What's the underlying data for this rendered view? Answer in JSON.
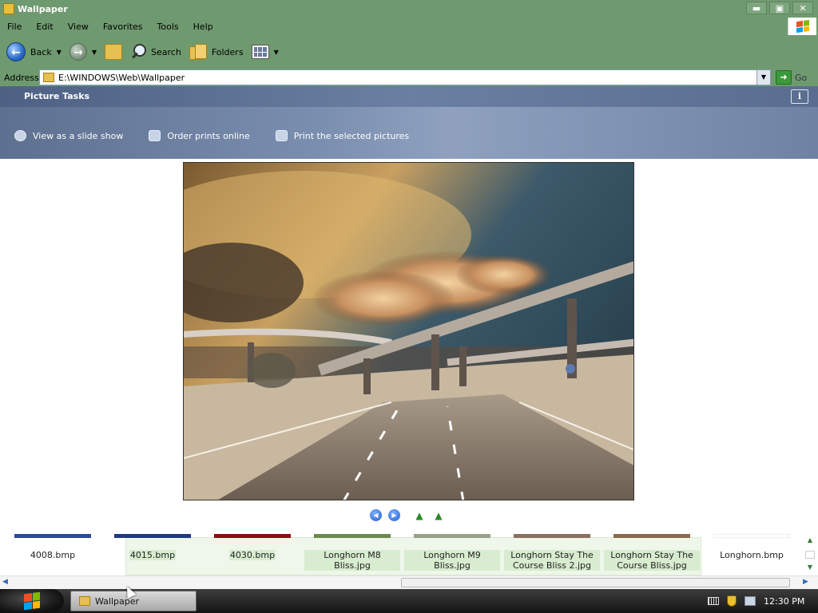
{
  "window": {
    "title": "Wallpaper",
    "min": "▬",
    "max": "▣",
    "close": "✕"
  },
  "menu": [
    "File",
    "Edit",
    "View",
    "Favorites",
    "Tools",
    "Help"
  ],
  "toolbar": {
    "back": "Back",
    "search": "Search",
    "folders": "Folders"
  },
  "address": {
    "label": "Address",
    "value": "E:\\WINDOWS\\Web\\Wallpaper",
    "go": "Go"
  },
  "tasks": {
    "title": "Picture Tasks",
    "info": "i",
    "items": [
      {
        "label": "View as a slide show",
        "icon": "slideshow-icon"
      },
      {
        "label": "Order prints online",
        "icon": "order-prints-icon"
      },
      {
        "label": "Print the selected pictures",
        "icon": "printer-icon"
      }
    ]
  },
  "filmstrip": {
    "items": [
      {
        "name": "4008.bmp",
        "strip": "#2a4a9a",
        "selected": false
      },
      {
        "name": "4015.bmp",
        "strip": "#1f3a80",
        "selected": true
      },
      {
        "name": "4030.bmp",
        "strip": "#8a1010",
        "selected": true
      },
      {
        "name": "Longhorn M8 Bliss.jpg",
        "strip": "#6a8a50",
        "selected": true
      },
      {
        "name": "Longhorn M9 Bliss.jpg",
        "strip": "#9aa08a",
        "selected": true
      },
      {
        "name": "Longhorn Stay The Course Bliss 2.jpg",
        "strip": "#8a7060",
        "selected": true
      },
      {
        "name": "Longhorn Stay The Course Bliss.jpg",
        "strip": "#8a6a50",
        "selected": true
      },
      {
        "name": "Longhorn.bmp",
        "strip": "#ffffff",
        "selected": false
      }
    ]
  },
  "taskbar": {
    "window_button": "Wallpaper",
    "clock": "12:30 PM"
  }
}
